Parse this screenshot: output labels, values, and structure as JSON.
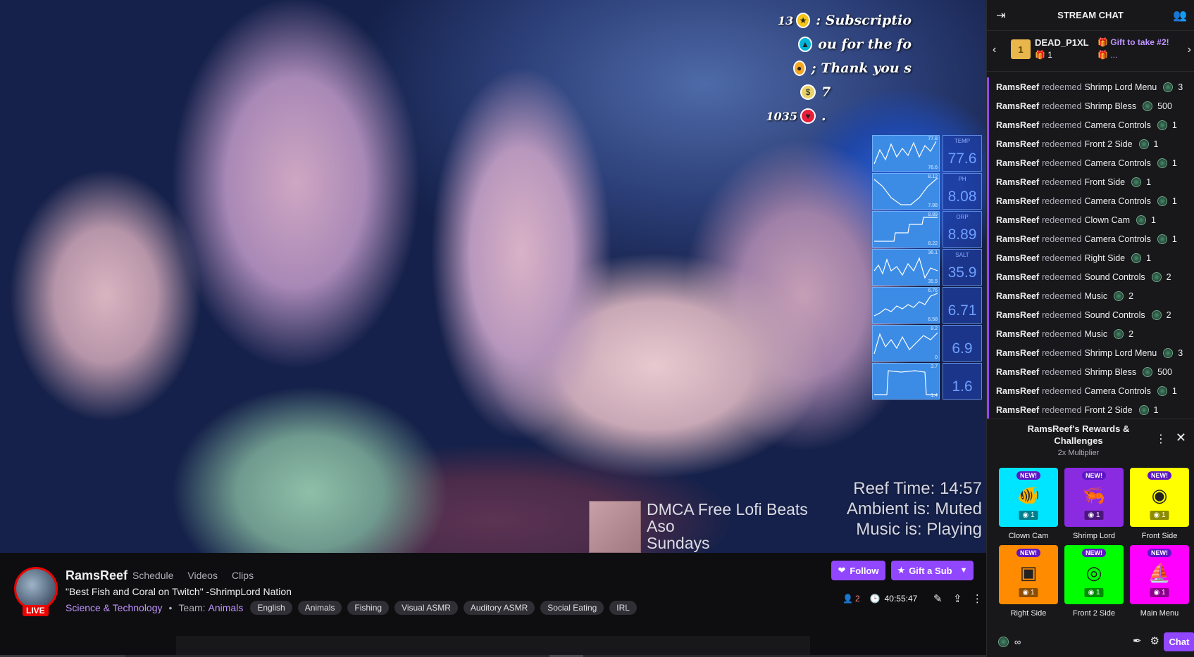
{
  "video": {
    "alerts": [
      {
        "num": "13",
        "badge_color": "#f5c518",
        "badge_icon": "star-icon",
        "text": ": Subscriptio"
      },
      {
        "num": "",
        "badge_color": "#00b5d8",
        "badge_icon": "triangle-icon",
        "text": "ou for the fo"
      },
      {
        "num": "",
        "badge_color": "#f5a623",
        "badge_icon": "coin-icon",
        "text": "; Thank you s"
      },
      {
        "num": "",
        "badge_color": "#e8d36a",
        "badge_icon": "bag-icon",
        "text": "7"
      },
      {
        "num": "1035",
        "badge_color": "#e91e3c",
        "badge_icon": "heart-icon",
        "text": "."
      }
    ],
    "sensors": [
      {
        "label": "TEMP",
        "value": "77.6",
        "hi": "77.8",
        "lo": "76.6"
      },
      {
        "label": "PH",
        "value": "8.08",
        "hi": "8.12",
        "lo": "7.88"
      },
      {
        "label": "ORP",
        "value": "8.89",
        "hi": "8.89",
        "lo": "8.22"
      },
      {
        "label": "SALT",
        "value": "35.9",
        "hi": "36.1",
        "lo": "35.5"
      },
      {
        "label": "",
        "value": "6.71",
        "hi": "6.76",
        "lo": "6.58"
      },
      {
        "label": "",
        "value": "6.9",
        "hi": "8.2",
        "lo": "0"
      },
      {
        "label": "",
        "value": "1.6",
        "hi": "3.7",
        "lo": "1.4"
      }
    ],
    "reef_time": "Reef Time: 14:57",
    "ambient": "Ambient is: Muted",
    "music_status": "Music is:  Playing",
    "music_line1": "DMCA Free Lofi Beats",
    "music_line2": "Aso",
    "music_line3": "Sundays"
  },
  "channel": {
    "live_label": "LIVE",
    "name": "RamsReef",
    "links": [
      "Schedule",
      "Videos",
      "Clips"
    ],
    "title": "\"Best Fish and Coral on Twitch\" -ShrimpLord Nation",
    "category": "Science & Technology",
    "team_label": "Team:",
    "team": "Animals",
    "tags": [
      "English",
      "Animals",
      "Fishing",
      "Visual ASMR",
      "Auditory ASMR",
      "Social Eating",
      "IRL"
    ],
    "follow_label": "Follow",
    "gift_label": "Gift a Sub",
    "viewers": "2",
    "uptime": "40:55:47"
  },
  "chat": {
    "header_title": "STREAM CHAT",
    "gift_user": "DEAD_P1XL",
    "gift_count": "1",
    "gift_box_num": "1",
    "gift_take": "Gift to take #2!",
    "gift_more": "...",
    "messages": [
      {
        "user": "RamsReef",
        "verb": "redeemed",
        "reward": "Shrimp Lord Menu",
        "cost": "3"
      },
      {
        "user": "RamsReef",
        "verb": "redeemed",
        "reward": "Shrimp Bless",
        "cost": "500"
      },
      {
        "user": "RamsReef",
        "verb": "redeemed",
        "reward": "Camera Controls",
        "cost": "1"
      },
      {
        "user": "RamsReef",
        "verb": "redeemed",
        "reward": "Front 2 Side",
        "cost": "1"
      },
      {
        "user": "RamsReef",
        "verb": "redeemed",
        "reward": "Camera Controls",
        "cost": "1"
      },
      {
        "user": "RamsReef",
        "verb": "redeemed",
        "reward": "Front Side",
        "cost": "1"
      },
      {
        "user": "RamsReef",
        "verb": "redeemed",
        "reward": "Camera Controls",
        "cost": "1"
      },
      {
        "user": "RamsReef",
        "verb": "redeemed",
        "reward": "Clown Cam",
        "cost": "1"
      },
      {
        "user": "RamsReef",
        "verb": "redeemed",
        "reward": "Camera Controls",
        "cost": "1"
      },
      {
        "user": "RamsReef",
        "verb": "redeemed",
        "reward": "Right Side",
        "cost": "1"
      },
      {
        "user": "RamsReef",
        "verb": "redeemed",
        "reward": "Sound Controls",
        "cost": "2"
      },
      {
        "user": "RamsReef",
        "verb": "redeemed",
        "reward": "Music",
        "cost": "2"
      },
      {
        "user": "RamsReef",
        "verb": "redeemed",
        "reward": "Sound Controls",
        "cost": "2"
      },
      {
        "user": "RamsReef",
        "verb": "redeemed",
        "reward": "Music",
        "cost": "2"
      },
      {
        "user": "RamsReef",
        "verb": "redeemed",
        "reward": "Shrimp Lord Menu",
        "cost": "3"
      },
      {
        "user": "RamsReef",
        "verb": "redeemed",
        "reward": "Shrimp Bless",
        "cost": "500"
      },
      {
        "user": "RamsReef",
        "verb": "redeemed",
        "reward": "Camera Controls",
        "cost": "1"
      },
      {
        "user": "RamsReef",
        "verb": "redeemed",
        "reward": "Front 2 Side",
        "cost": "1"
      }
    ],
    "rewards_title": "RamsReef's Rewards & Challenges",
    "rewards_subtitle": "2x Multiplier",
    "rewards": [
      {
        "label": "Clown Cam",
        "color": "#00e5ff",
        "icon": "fish-icon",
        "glyph": "🐠",
        "badge": "NEW!",
        "cost": "1"
      },
      {
        "label": "Shrimp Lord",
        "color": "#8a2be2",
        "icon": "shrimp-icon",
        "glyph": "🦐",
        "badge": "NEW!",
        "cost": "1"
      },
      {
        "label": "Front Side",
        "color": "#ffff00",
        "icon": "camera-icon",
        "glyph": "◉",
        "badge": "NEW!",
        "cost": "1"
      },
      {
        "label": "Right Side",
        "color": "#ff8c00",
        "icon": "video-camera-icon",
        "glyph": "▣",
        "badge": "NEW!",
        "cost": "1"
      },
      {
        "label": "Front 2 Side",
        "color": "#00ff00",
        "icon": "lens-icon",
        "glyph": "◎",
        "badge": "NEW!",
        "cost": "1"
      },
      {
        "label": "Main Menu",
        "color": "#ff00ff",
        "icon": "ship-icon",
        "glyph": "⛵",
        "badge": "NEW!",
        "cost": "1"
      }
    ],
    "points": "∞",
    "chat_button": "Chat"
  }
}
